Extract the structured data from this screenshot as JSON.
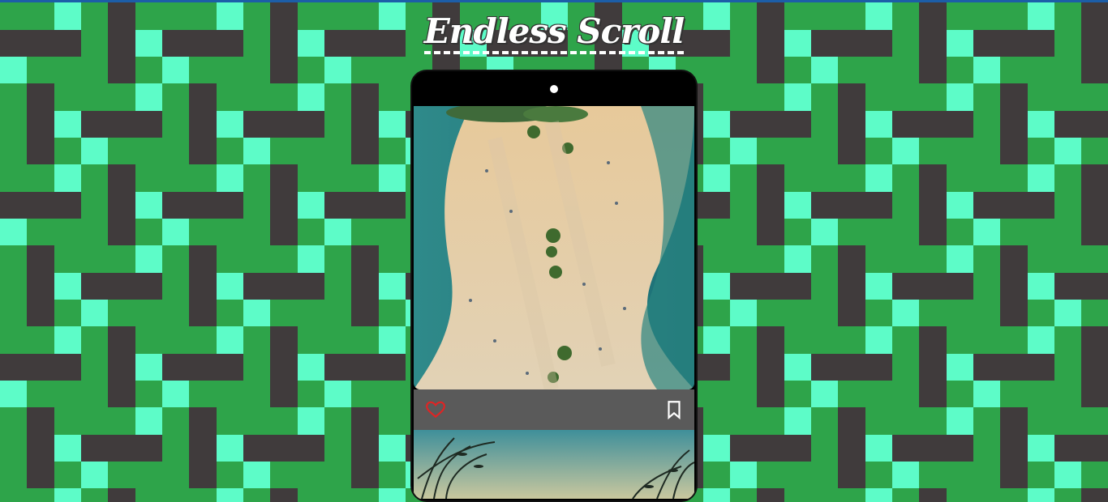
{
  "page": {
    "title": "Endless Scroll"
  },
  "colors": {
    "background_green": "#2ea44a",
    "background_mint": "#5dfcc8",
    "background_dark": "#403b3c",
    "phone_frame": "#000000",
    "action_bar": "#5a5a5a",
    "like_red": "#e02424"
  },
  "posts": [
    {
      "image": "aerial-beach-with-palm-trees",
      "actions": {
        "like_icon": "heart-outline-icon",
        "save_icon": "bookmark-outline-icon"
      }
    },
    {
      "image": "beach-grass-sky"
    }
  ]
}
